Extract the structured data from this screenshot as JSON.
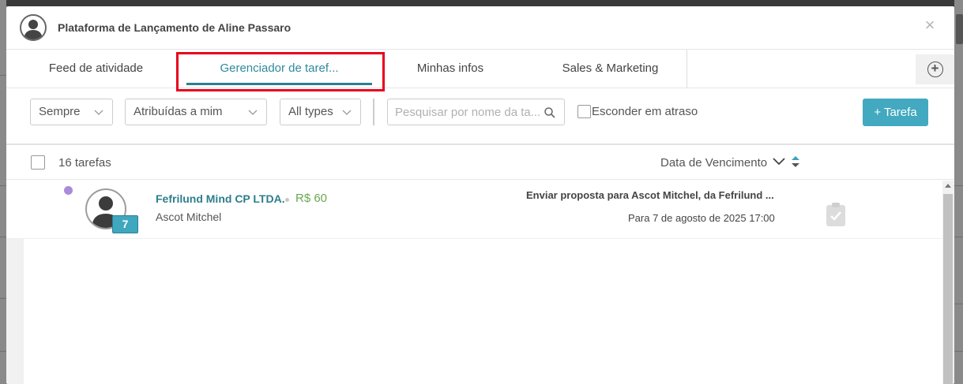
{
  "modal": {
    "title": "Plataforma de Lançamento de Aline Passaro",
    "close_label": "×"
  },
  "tabs": [
    {
      "label": "Feed de atividade",
      "active": false
    },
    {
      "label": "Gerenciador de taref...",
      "active": true
    },
    {
      "label": "Minhas infos",
      "active": false
    },
    {
      "label": "Sales & Marketing",
      "active": false
    }
  ],
  "add_tab_label": "+",
  "filters": {
    "period": "Sempre",
    "assignee": "Atribuídas a mim",
    "type": "All types",
    "search_placeholder": "Pesquisar por nome da ta...",
    "hide_overdue_label": "Esconder em atraso",
    "add_task_label": "+ Tarefa"
  },
  "list": {
    "count_label": "16 tarefas",
    "sort_label": "Data de Vencimento"
  },
  "tasks": [
    {
      "organization": "Fefrilund Mind CP LTDA.",
      "value": "R$ 60",
      "person": "Ascot Mitchel",
      "badge": "7",
      "title": "Enviar proposta para Ascot Mitchel, da Fefrilund ...",
      "due": "Para 7 de agosto de 2025 17:00"
    }
  ],
  "colors": {
    "accent": "#42a9c0",
    "tab_active": "#2e8a9c",
    "highlight": "#e8001c",
    "value_green": "#6aa84f",
    "status_dot": "#a98bd9"
  }
}
